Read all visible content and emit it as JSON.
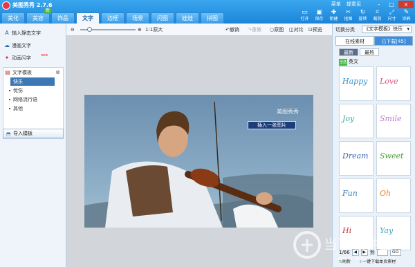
{
  "app": {
    "title": "美图秀秀 2.7.6",
    "top_links": [
      "菜单",
      "提意见"
    ],
    "window_buttons": [
      "-",
      "□",
      "×"
    ]
  },
  "main_tabs": [
    {
      "label": "美化",
      "active": false
    },
    {
      "label": "美容",
      "active": false,
      "badge": "新"
    },
    {
      "label": "饰品",
      "active": false
    },
    {
      "label": "文字",
      "active": true
    },
    {
      "label": "边框",
      "active": false
    },
    {
      "label": "场景",
      "active": false
    },
    {
      "label": "闪图",
      "active": false
    },
    {
      "label": "娃娃",
      "active": false
    },
    {
      "label": "拼图",
      "active": false
    }
  ],
  "toolbar": [
    {
      "label": "打开",
      "icon": "folder-icon",
      "glyph": "▭"
    },
    {
      "label": "保存",
      "icon": "save-icon",
      "glyph": "▣"
    },
    {
      "label": "新建",
      "icon": "new-icon",
      "glyph": "✚"
    },
    {
      "label": "抠图",
      "icon": "cutout-icon",
      "glyph": "✂"
    },
    {
      "label": "旋转",
      "icon": "rotate-icon",
      "glyph": "↻"
    },
    {
      "label": "裁剪",
      "icon": "crop-icon",
      "glyph": "⌗"
    },
    {
      "label": "尺寸",
      "icon": "resize-icon",
      "glyph": "⤢"
    },
    {
      "label": "涂鸦",
      "icon": "brush-icon",
      "glyph": "✎"
    }
  ],
  "left_panel": {
    "items": [
      {
        "label": "输入静态文字",
        "icon": "text-a-icon",
        "glyph": "A"
      },
      {
        "label": "漫画文字",
        "icon": "bubble-icon",
        "glyph": "☁"
      },
      {
        "label": "动画闪字",
        "icon": "sparkle-icon",
        "glyph": "✦",
        "tag": "new"
      }
    ],
    "template_group": {
      "title": "文字模板",
      "subitems": [
        {
          "label": "快乐",
          "active": true
        },
        {
          "label": "忧伤",
          "active": false
        },
        {
          "label": "网络流行语",
          "active": false
        },
        {
          "label": "其他",
          "active": false
        }
      ]
    },
    "import_button": "导入模板"
  },
  "canvas_toolbar": {
    "zoom_label": "1:1原大",
    "actions": [
      "撤销",
      "重做",
      "原图",
      "对比",
      "预览"
    ]
  },
  "photo": {
    "watermark": "美图秀秀",
    "insert_button": "插入一张图片"
  },
  "right_panel": {
    "category_label": "切换分类",
    "category_value": "《文字模板》快乐",
    "tabs": [
      "在线素材",
      "已下载[45]"
    ],
    "subtabs": [
      {
        "label": "最新",
        "active": true
      },
      {
        "label": "最热",
        "active": false
      }
    ],
    "lang_check": "全选",
    "lang": "英文",
    "thumbnails": [
      {
        "text": "Happy",
        "color": "#3a8fc9"
      },
      {
        "text": "Love",
        "color": "#d9567a"
      },
      {
        "text": "Joy",
        "color": "#3aa99c"
      },
      {
        "text": "Smile",
        "color": "#c07ad0"
      },
      {
        "text": "Dream",
        "color": "#4466aa"
      },
      {
        "text": "Sweet",
        "color": "#4d9a3e"
      },
      {
        "text": "Fun",
        "color": "#2f7fc1"
      },
      {
        "text": "Oh",
        "color": "#e0872c"
      },
      {
        "text": "Hi",
        "color": "#c0383f"
      },
      {
        "text": "Yay",
        "color": "#3aa5b8"
      }
    ],
    "pager": {
      "page": "1/66",
      "go_to": "到",
      "go": "GO"
    },
    "footer": [
      "刷新",
      "一键下载本页素材"
    ]
  }
}
